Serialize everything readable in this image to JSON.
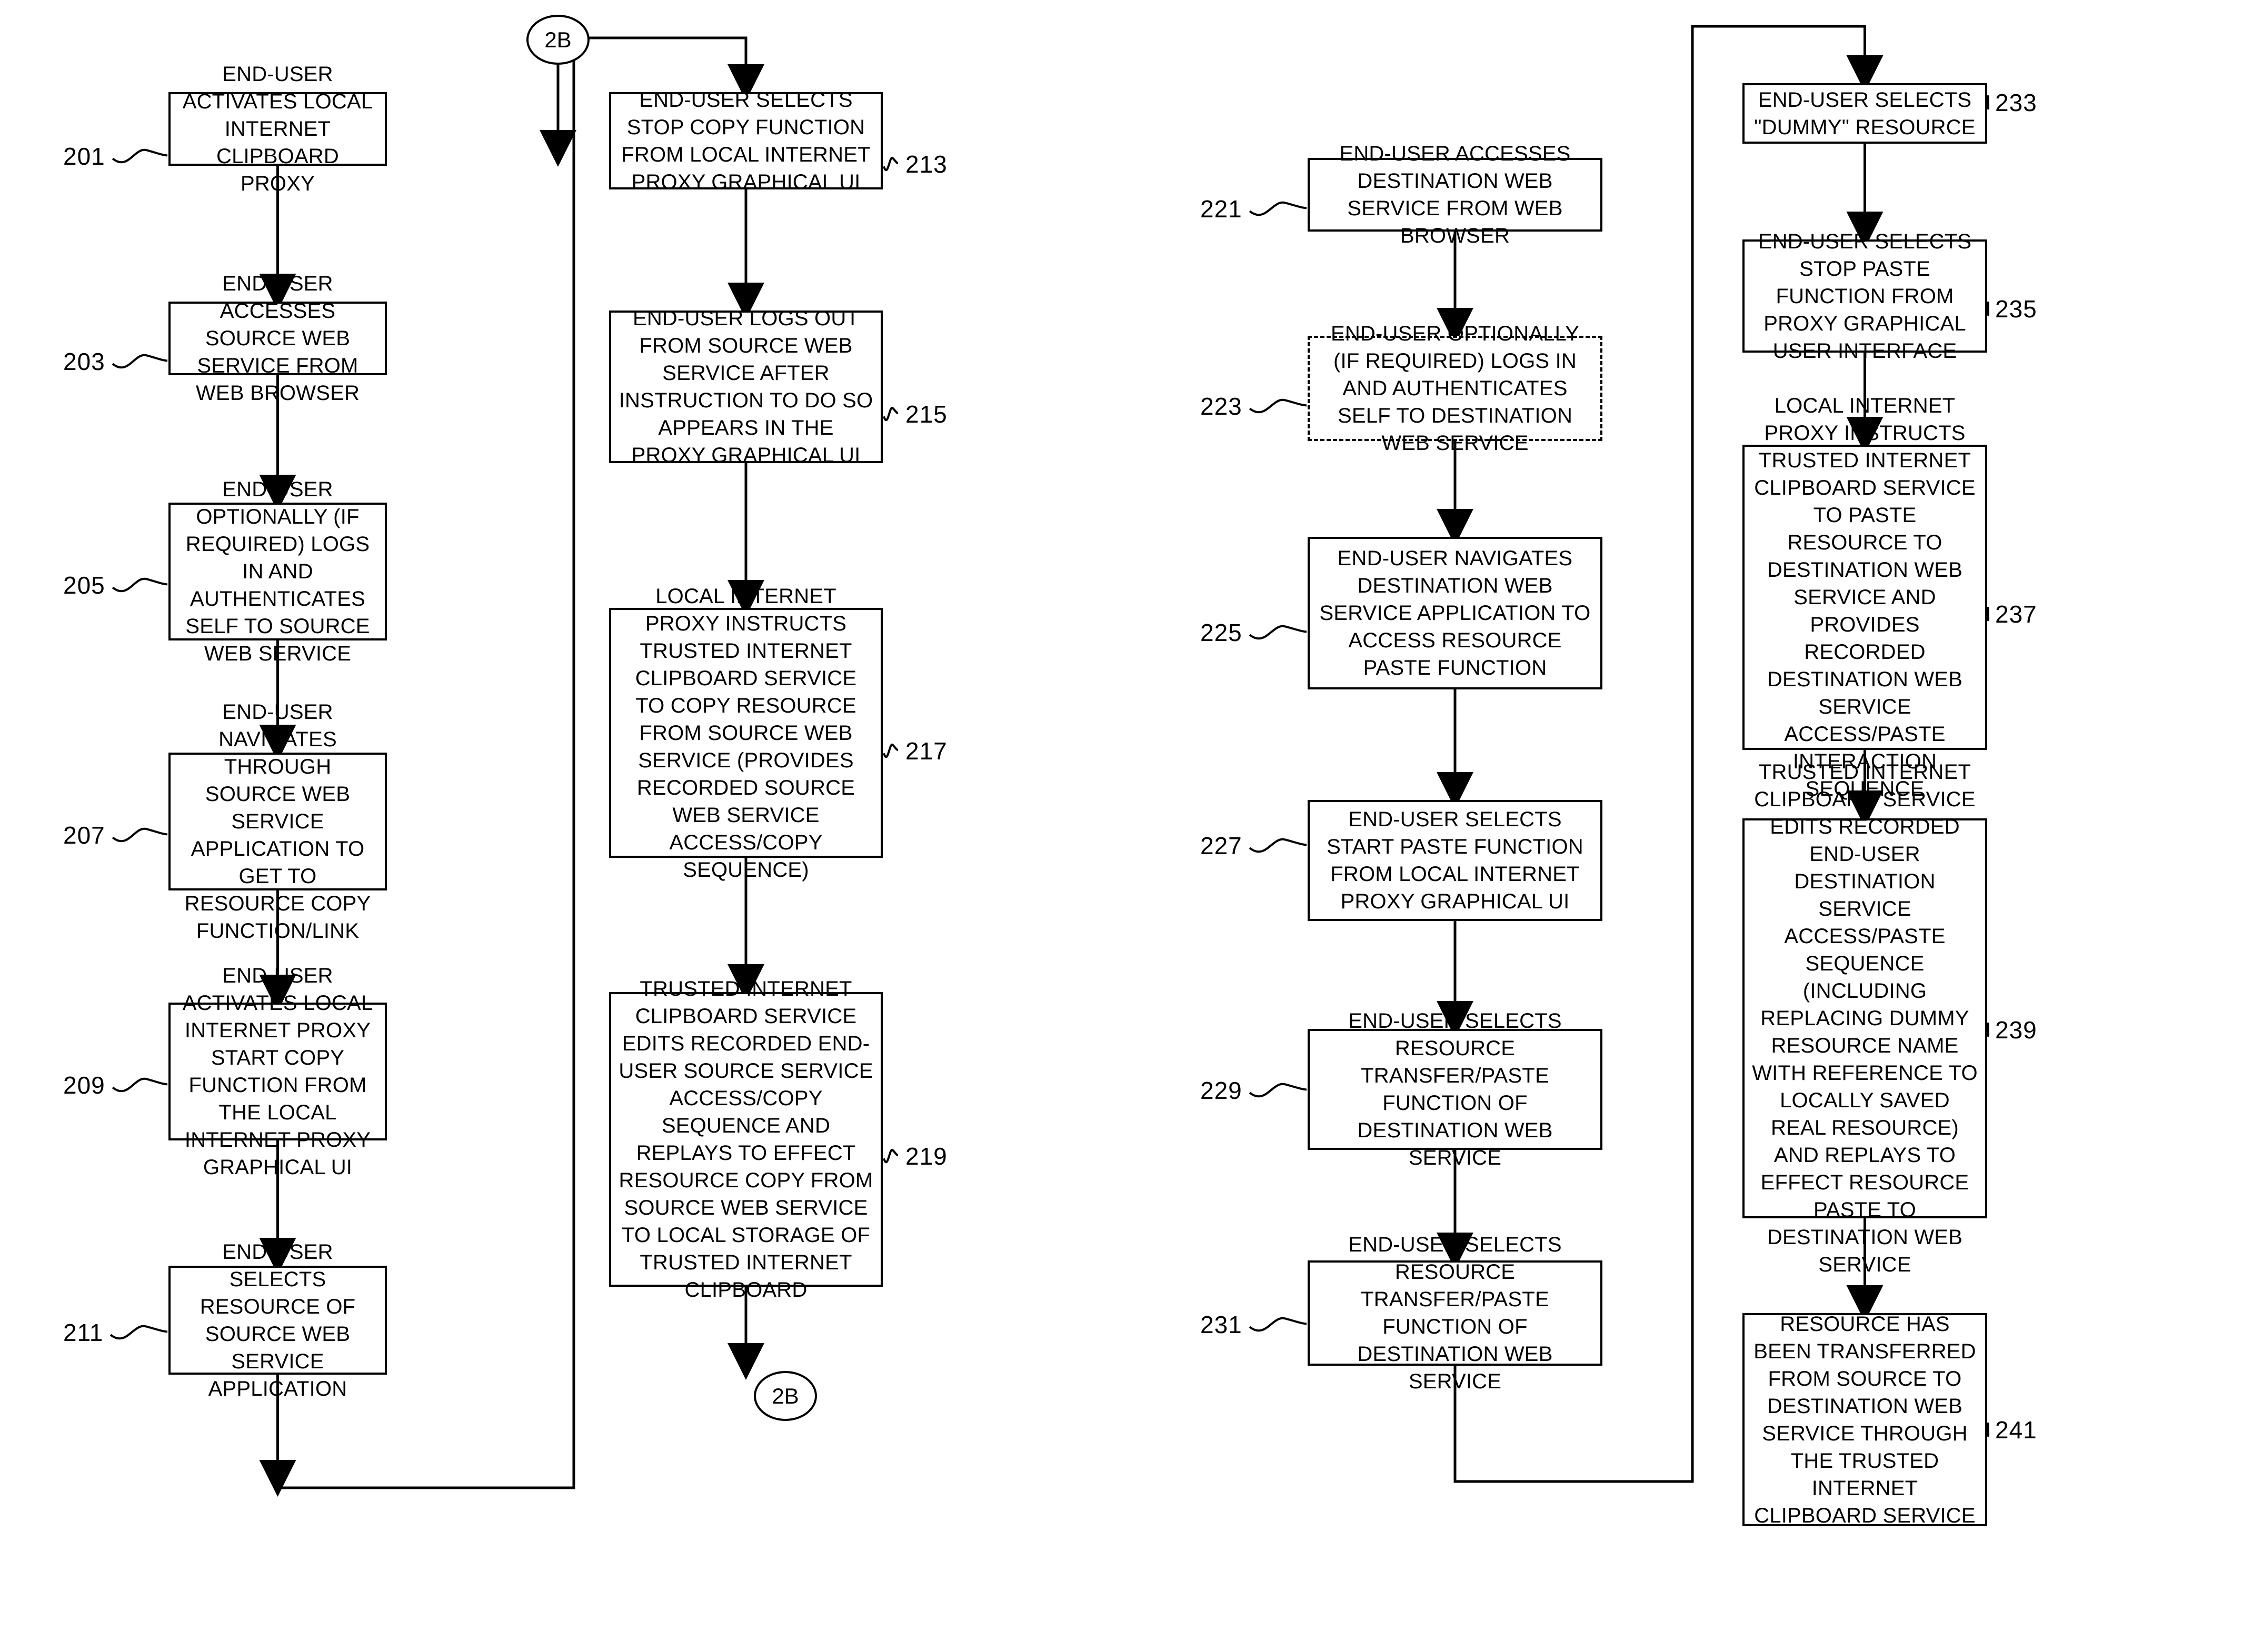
{
  "figure": {
    "type": "patent-flowchart",
    "title": "",
    "connector_labels": [
      "2B",
      "2B"
    ]
  },
  "columns": [
    {
      "id": "column-1",
      "nodes": [
        {
          "ref": "201",
          "ref_side": "left",
          "style": "solid",
          "text": "END-USER ACTIVATES LOCAL INTERNET CLIPBOARD PROXY"
        },
        {
          "ref": "203",
          "ref_side": "left",
          "style": "solid",
          "text": "END-USER ACCESSES SOURCE WEB SERVICE FROM WEB BROWSER"
        },
        {
          "ref": "205",
          "ref_side": "left",
          "style": "solid",
          "text": "END-USER OPTIONALLY (IF REQUIRED) LOGS IN AND AUTHENTICATES SELF TO SOURCE WEB SERVICE"
        },
        {
          "ref": "207",
          "ref_side": "left",
          "style": "solid",
          "text": "END-USER NAVIGATES THROUGH SOURCE WEB SERVICE APPLICATION TO GET TO RESOURCE COPY FUNCTION/LINK"
        },
        {
          "ref": "209",
          "ref_side": "left",
          "style": "solid",
          "text": "END-USER ACTIVATES LOCAL INTERNET PROXY START COPY FUNCTION FROM THE LOCAL INTERNET PROXY GRAPHICAL UI"
        },
        {
          "ref": "211",
          "ref_side": "left",
          "style": "solid",
          "text": "END-USER SELECTS RESOURCE OF SOURCE WEB SERVICE APPLICATION"
        }
      ]
    },
    {
      "id": "column-2",
      "nodes": [
        {
          "ref": "213",
          "ref_side": "right",
          "style": "solid",
          "text": "END-USER SELECTS STOP COPY FUNCTION FROM LOCAL INTERNET PROXY GRAPHICAL UI"
        },
        {
          "ref": "215",
          "ref_side": "right",
          "style": "solid",
          "text": "END-USER LOGS OUT FROM SOURCE WEB SERVICE AFTER INSTRUCTION TO DO SO APPEARS IN THE PROXY GRAPHICAL UI"
        },
        {
          "ref": "217",
          "ref_side": "right",
          "style": "solid",
          "text": "LOCAL INTERNET PROXY INSTRUCTS TRUSTED INTERNET CLIPBOARD SERVICE TO COPY RESOURCE FROM SOURCE WEB SERVICE (PROVIDES RECORDED SOURCE WEB SERVICE ACCESS/COPY SEQUENCE)"
        },
        {
          "ref": "219",
          "ref_side": "right",
          "style": "solid",
          "text": "TRUSTED INTERNET CLIPBOARD SERVICE EDITS RECORDED END-USER SOURCE SERVICE ACCESS/COPY SEQUENCE AND REPLAYS TO EFFECT RESOURCE COPY FROM SOURCE WEB SERVICE TO LOCAL STORAGE OF TRUSTED INTERNET CLIPBOARD"
        }
      ],
      "exit_connector": "2B"
    },
    {
      "id": "column-3",
      "entry_connector": "2B",
      "nodes": [
        {
          "ref": "221",
          "ref_side": "left",
          "style": "solid",
          "text": "END-USER ACCESSES DESTINATION WEB SERVICE FROM WEB BROWSER"
        },
        {
          "ref": "223",
          "ref_side": "left",
          "style": "dashed",
          "text": "END-USER OPTIONALLY (IF REQUIRED) LOGS IN AND AUTHENTICATES SELF TO DESTINATION WEB SERVICE"
        },
        {
          "ref": "225",
          "ref_side": "left",
          "style": "solid",
          "text": "END-USER NAVIGATES DESTINATION WEB SERVICE APPLICATION TO ACCESS RESOURCE PASTE FUNCTION"
        },
        {
          "ref": "227",
          "ref_side": "left",
          "style": "solid",
          "text": "END-USER SELECTS START PASTE FUNCTION FROM LOCAL INTERNET PROXY GRAPHICAL UI"
        },
        {
          "ref": "229",
          "ref_side": "left",
          "style": "solid",
          "text": "END-USER SELECTS RESOURCE TRANSFER/PASTE FUNCTION OF DESTINATION WEB SERVICE"
        },
        {
          "ref": "231",
          "ref_side": "left",
          "style": "solid",
          "text": "END-USER SELECTS RESOURCE TRANSFER/PASTE FUNCTION OF DESTINATION WEB SERVICE"
        }
      ]
    },
    {
      "id": "column-4",
      "nodes": [
        {
          "ref": "233",
          "ref_side": "right",
          "style": "solid",
          "text": "END-USER SELECTS \"DUMMY\" RESOURCE"
        },
        {
          "ref": "235",
          "ref_side": "right",
          "style": "solid",
          "text": "END-USER SELECTS STOP PASTE FUNCTION FROM PROXY GRAPHICAL USER INTERFACE"
        },
        {
          "ref": "237",
          "ref_side": "right",
          "style": "solid",
          "text": "LOCAL INTERNET PROXY INSTRUCTS TRUSTED INTERNET CLIPBOARD SERVICE TO PASTE RESOURCE TO DESTINATION WEB SERVICE AND PROVIDES RECORDED DESTINATION WEB SERVICE ACCESS/PASTE INTERACTION SEQUENCE"
        },
        {
          "ref": "239",
          "ref_side": "right",
          "style": "solid",
          "text": "TRUSTED INTERNET CLIPBOARD SERVICE EDITS RECORDED END-USER DESTINATION SERVICE ACCESS/PASTE SEQUENCE (INCLUDING REPLACING DUMMY RESOURCE NAME WITH REFERENCE TO LOCALLY SAVED REAL RESOURCE) AND REPLAYS TO EFFECT RESOURCE PASTE TO DESTINATION WEB SERVICE"
        },
        {
          "ref": "241",
          "ref_side": "right",
          "style": "solid",
          "text": "RESOURCE HAS BEEN TRANSFERRED FROM SOURCE TO DESTINATION WEB SERVICE THROUGH THE TRUSTED INTERNET CLIPBOARD SERVICE"
        }
      ]
    }
  ]
}
